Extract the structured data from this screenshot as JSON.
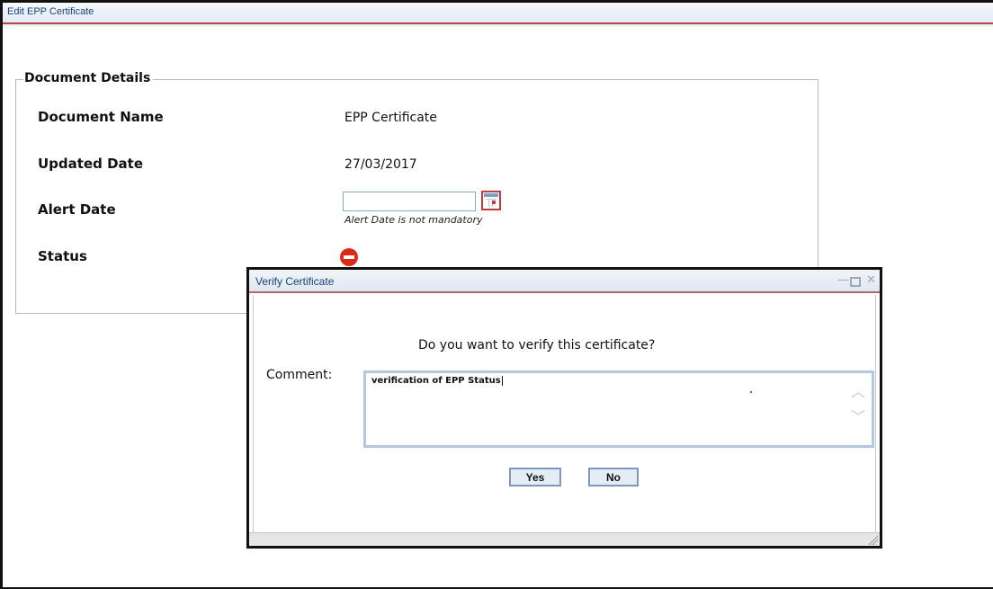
{
  "window": {
    "title": "Edit EPP Certificate"
  },
  "document_details": {
    "legend": "Document Details",
    "rows": [
      {
        "label": "Document Name",
        "value": "EPP Certificate"
      },
      {
        "label": "Updated Date",
        "value": "27/03/2017"
      },
      {
        "label": "Alert Date",
        "value": ""
      },
      {
        "label": "Status",
        "value": ""
      }
    ],
    "alert_date_input": {
      "value": "",
      "placeholder": ""
    },
    "alert_date_hint": "Alert Date is not mandatory",
    "status_icon": "no-entry-icon"
  },
  "dialog": {
    "title": "Verify Certificate",
    "controls": {
      "minimize": "—",
      "maximize": "",
      "close": "✕"
    },
    "question": "Do you want to verify this certificate?",
    "comment_label": "Comment:",
    "comment_value": "verification of EPP Status",
    "yes_label": "Yes",
    "no_label": "No"
  },
  "colors": {
    "title_text": "#1b3f7a",
    "title_border": "#b04848",
    "status_red": "#dd2a17",
    "button_bg": "#e4ecf6",
    "button_border": "#7d97bd"
  }
}
